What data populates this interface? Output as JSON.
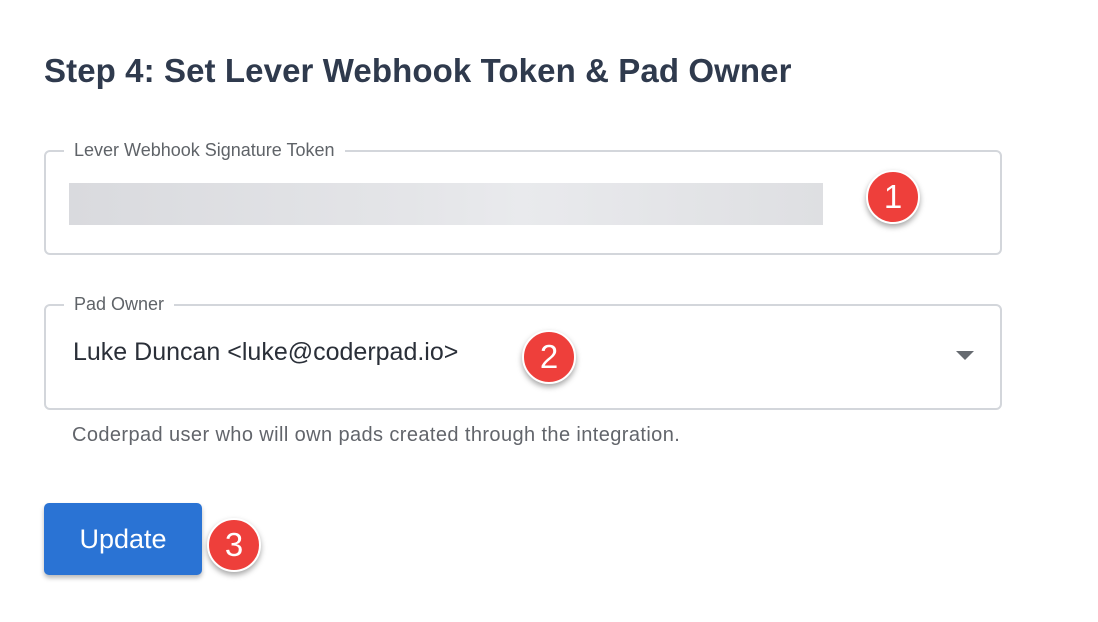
{
  "page": {
    "heading": "Step 4: Set Lever Webhook Token & Pad Owner"
  },
  "token_field": {
    "label": "Lever Webhook Signature Token",
    "value_redacted": true
  },
  "owner_field": {
    "label": "Pad Owner",
    "selected_value": "Luke Duncan <luke@coderpad.io>",
    "helper_text": "Coderpad user who will own pads created through the integration.",
    "icon": "caret-down-icon"
  },
  "actions": {
    "update_label": "Update"
  },
  "callouts": [
    "1",
    "2",
    "3"
  ],
  "colors": {
    "primary": "#2a73d4",
    "callout": "#ee3f3b"
  }
}
